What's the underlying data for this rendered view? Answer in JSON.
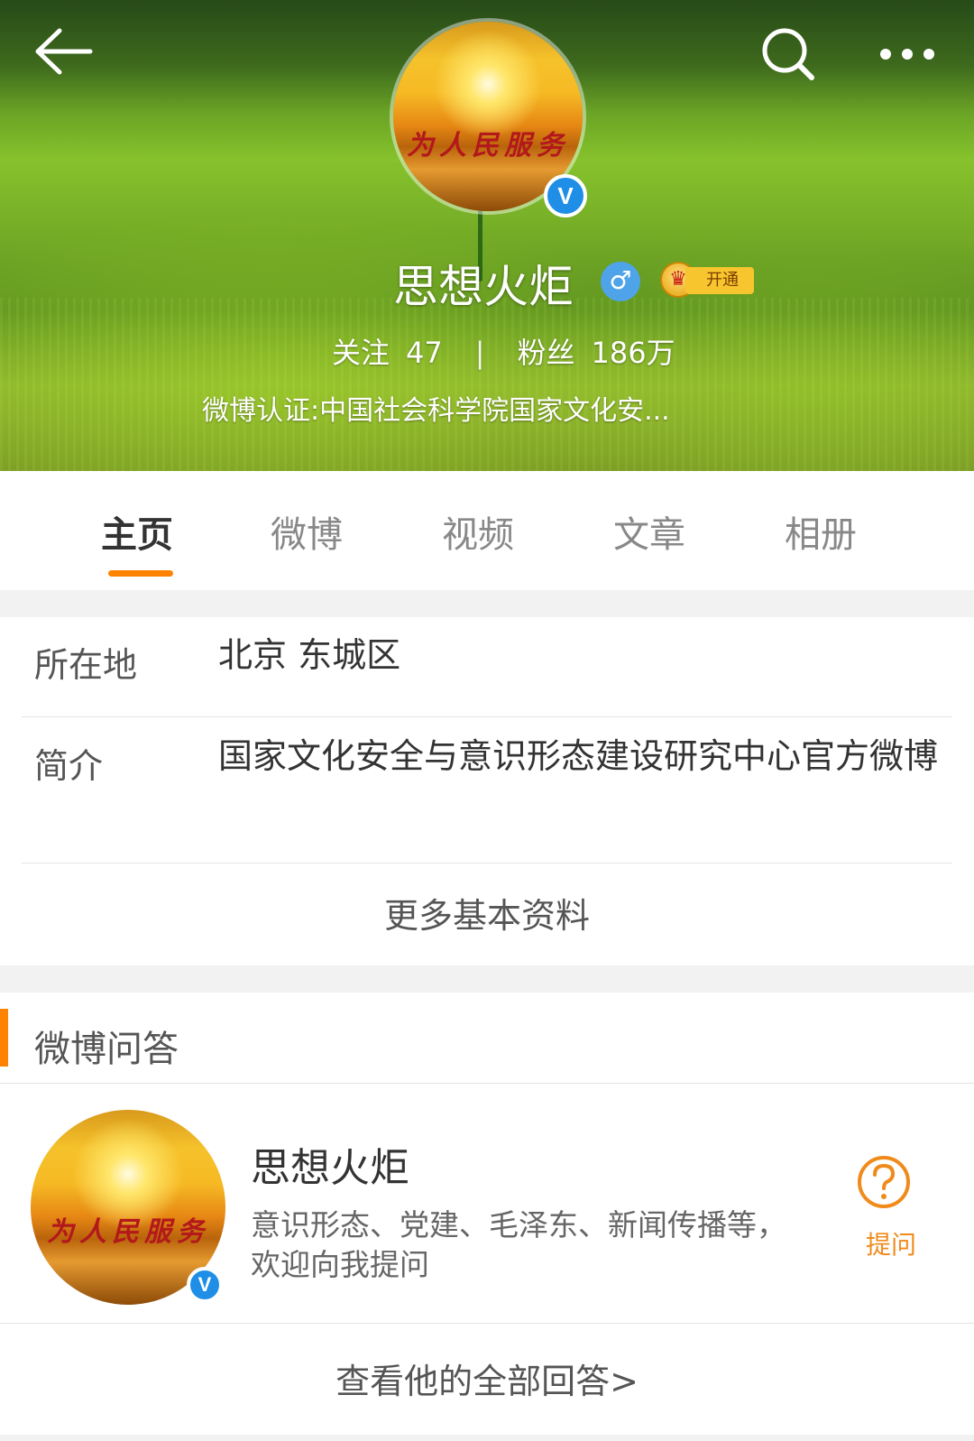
{
  "profile": {
    "name": "思想火炬",
    "gender_symbol": "♂",
    "vip_label": "开通",
    "verified_badge": "V",
    "following_label": "关注",
    "following_count": "47",
    "separator": "|",
    "fans_label": "粉丝",
    "fans_count": "186万",
    "verification": "微博认证:中国社会科学院国家文化安..."
  },
  "tabs": [
    {
      "label": "主页",
      "active": true
    },
    {
      "label": "微博",
      "active": false
    },
    {
      "label": "视频",
      "active": false
    },
    {
      "label": "文章",
      "active": false
    },
    {
      "label": "相册",
      "active": false
    }
  ],
  "info": {
    "location_label": "所在地",
    "location_value": "北京 东城区",
    "intro_label": "简介",
    "intro_value": "国家文化安全与意识形态建设研究中心官方微博",
    "more_link": "更多基本资料"
  },
  "qa": {
    "section_title": "微博问答",
    "name": "思想火炬",
    "description": "意识形态、党建、毛泽东、新闻传播等，欢迎向我提问",
    "ask_label": "提问",
    "view_all": "查看他的全部回答>"
  },
  "avatar_text": "为人民服务",
  "colors": {
    "accent": "#ff8200",
    "verified_blue": "#1e8ee6",
    "ask_orange": "#f08a1b"
  }
}
